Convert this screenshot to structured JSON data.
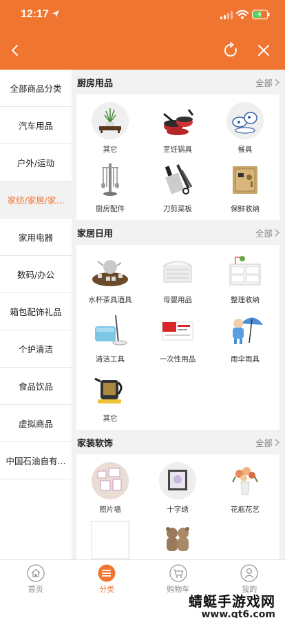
{
  "status_bar": {
    "time": "12:17"
  },
  "sidebar": {
    "items": [
      {
        "label": "全部商品分类"
      },
      {
        "label": "汽车用品"
      },
      {
        "label": "户外/运动"
      },
      {
        "label": "家纺/家居/家..."
      },
      {
        "label": "家用电器"
      },
      {
        "label": "数码/办公"
      },
      {
        "label": "箱包配饰礼品"
      },
      {
        "label": "个护清洁"
      },
      {
        "label": "食品饮品"
      },
      {
        "label": "虚拟商品"
      },
      {
        "label": "中国石油自有..."
      }
    ],
    "active_index": 3
  },
  "sections": [
    {
      "title": "厨房用品",
      "all_label": "全部",
      "items": [
        {
          "label": "其它",
          "icon": "plant-decor-icon"
        },
        {
          "label": "烹饪锅具",
          "icon": "cookware-pots-icon"
        },
        {
          "label": "餐具",
          "icon": "tableware-set-icon"
        },
        {
          "label": "厨房配件",
          "icon": "utensil-rack-icon"
        },
        {
          "label": "刀剪菜板",
          "icon": "knife-set-icon"
        },
        {
          "label": "保鲜收纳",
          "icon": "gold-safe-icon"
        }
      ]
    },
    {
      "title": "家居日用",
      "all_label": "全部",
      "items": [
        {
          "label": "水杯茶具酒具",
          "icon": "tea-set-icon"
        },
        {
          "label": "母婴用品",
          "icon": "towel-box-icon"
        },
        {
          "label": "整理收纳",
          "icon": "drawer-cabinet-icon"
        },
        {
          "label": "清洁工具",
          "icon": "spin-mop-icon"
        },
        {
          "label": "一次性用品",
          "icon": "disposable-pack-icon"
        },
        {
          "label": "雨伞雨具",
          "icon": "kid-umbrella-icon"
        },
        {
          "label": "其它",
          "icon": "kettle-icon"
        }
      ]
    },
    {
      "title": "家装软饰",
      "all_label": "全部",
      "items": [
        {
          "label": "照片墙",
          "icon": "photo-wall-icon"
        },
        {
          "label": "十字绣",
          "icon": "cross-stitch-frame-icon"
        },
        {
          "label": "花瓶花艺",
          "icon": "flower-vase-icon"
        },
        {
          "label": "",
          "icon": "blank-placeholder-icon"
        },
        {
          "label": "",
          "icon": "teddy-bears-icon"
        }
      ]
    }
  ],
  "tabbar": {
    "items": [
      {
        "label": "首页",
        "icon": "home-icon"
      },
      {
        "label": "分类",
        "icon": "category-icon"
      },
      {
        "label": "购物车",
        "icon": "cart-icon"
      },
      {
        "label": "我的",
        "icon": "profile-icon"
      }
    ],
    "active_index": 1
  },
  "watermark": {
    "title": "蜻蜓手游戏网",
    "url": "www.qt6.com"
  },
  "colors": {
    "accent": "#f07530",
    "background": "#f2f2f2",
    "text": "#222222",
    "muted": "#888888"
  }
}
